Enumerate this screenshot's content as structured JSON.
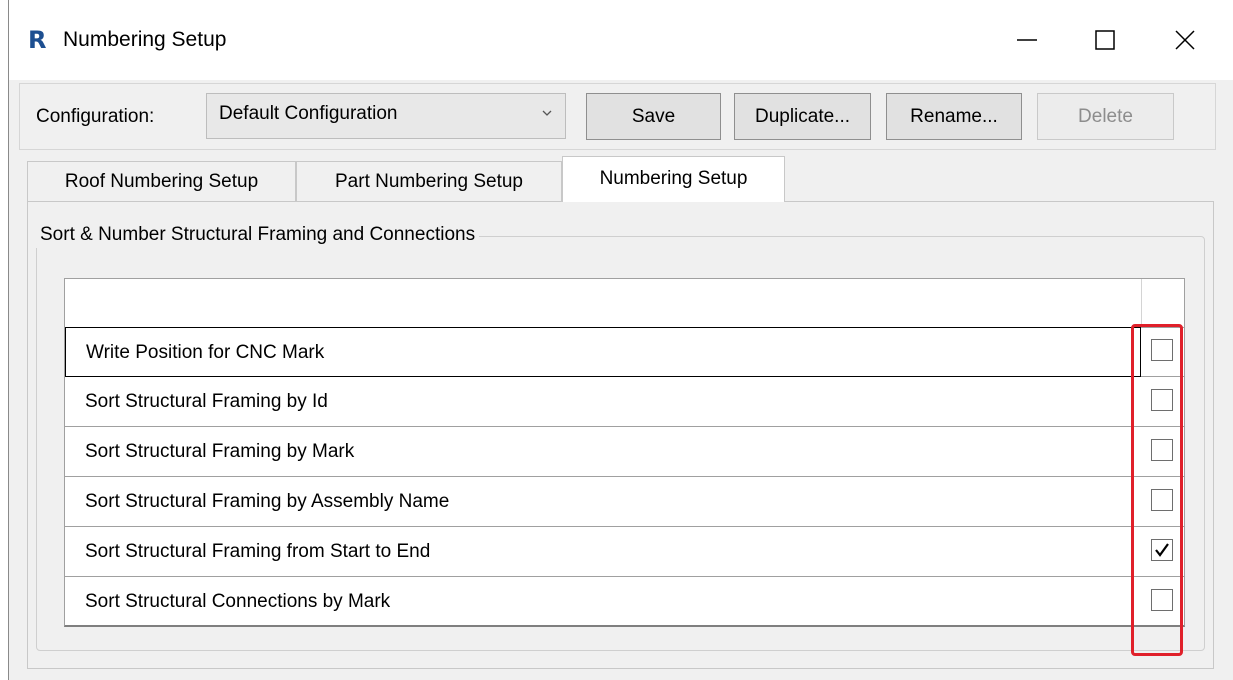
{
  "window": {
    "app_icon_letter": "R",
    "title": "Numbering Setup"
  },
  "toolbar": {
    "config_label": "Configuration:",
    "config_value": "Default Configuration",
    "save_label": "Save",
    "duplicate_label": "Duplicate...",
    "rename_label": "Rename...",
    "delete_label": "Delete"
  },
  "tabs": [
    {
      "label": "Roof Numbering Setup",
      "active": false
    },
    {
      "label": "Part Numbering Setup",
      "active": false
    },
    {
      "label": "Numbering Setup",
      "active": true
    }
  ],
  "group": {
    "title": "Sort & Number Structural Framing and Connections"
  },
  "options": [
    {
      "label": "Write Position for CNC Mark",
      "checked": false
    },
    {
      "label": "Sort Structural Framing by Id",
      "checked": false
    },
    {
      "label": "Sort Structural Framing by Mark",
      "checked": false
    },
    {
      "label": "Sort Structural Framing by Assembly Name",
      "checked": false
    },
    {
      "label": "Sort Structural Framing from Start to End",
      "checked": true
    },
    {
      "label": "Sort Structural Connections by Mark",
      "checked": false
    }
  ],
  "colors": {
    "highlight": "#e0202a",
    "app_icon": "#1d4f91"
  }
}
